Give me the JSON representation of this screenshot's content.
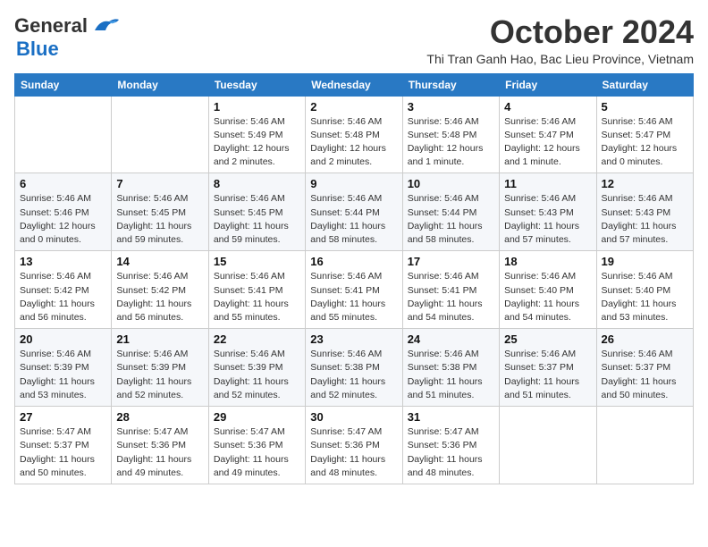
{
  "header": {
    "logo_general": "General",
    "logo_blue": "Blue",
    "month_title": "October 2024",
    "subtitle": "Thi Tran Ganh Hao, Bac Lieu Province, Vietnam"
  },
  "weekdays": [
    "Sunday",
    "Monday",
    "Tuesday",
    "Wednesday",
    "Thursday",
    "Friday",
    "Saturday"
  ],
  "weeks": [
    [
      {
        "day": "",
        "detail": ""
      },
      {
        "day": "",
        "detail": ""
      },
      {
        "day": "1",
        "detail": "Sunrise: 5:46 AM\nSunset: 5:49 PM\nDaylight: 12 hours\nand 2 minutes."
      },
      {
        "day": "2",
        "detail": "Sunrise: 5:46 AM\nSunset: 5:48 PM\nDaylight: 12 hours\nand 2 minutes."
      },
      {
        "day": "3",
        "detail": "Sunrise: 5:46 AM\nSunset: 5:48 PM\nDaylight: 12 hours\nand 1 minute."
      },
      {
        "day": "4",
        "detail": "Sunrise: 5:46 AM\nSunset: 5:47 PM\nDaylight: 12 hours\nand 1 minute."
      },
      {
        "day": "5",
        "detail": "Sunrise: 5:46 AM\nSunset: 5:47 PM\nDaylight: 12 hours\nand 0 minutes."
      }
    ],
    [
      {
        "day": "6",
        "detail": "Sunrise: 5:46 AM\nSunset: 5:46 PM\nDaylight: 12 hours\nand 0 minutes."
      },
      {
        "day": "7",
        "detail": "Sunrise: 5:46 AM\nSunset: 5:45 PM\nDaylight: 11 hours\nand 59 minutes."
      },
      {
        "day": "8",
        "detail": "Sunrise: 5:46 AM\nSunset: 5:45 PM\nDaylight: 11 hours\nand 59 minutes."
      },
      {
        "day": "9",
        "detail": "Sunrise: 5:46 AM\nSunset: 5:44 PM\nDaylight: 11 hours\nand 58 minutes."
      },
      {
        "day": "10",
        "detail": "Sunrise: 5:46 AM\nSunset: 5:44 PM\nDaylight: 11 hours\nand 58 minutes."
      },
      {
        "day": "11",
        "detail": "Sunrise: 5:46 AM\nSunset: 5:43 PM\nDaylight: 11 hours\nand 57 minutes."
      },
      {
        "day": "12",
        "detail": "Sunrise: 5:46 AM\nSunset: 5:43 PM\nDaylight: 11 hours\nand 57 minutes."
      }
    ],
    [
      {
        "day": "13",
        "detail": "Sunrise: 5:46 AM\nSunset: 5:42 PM\nDaylight: 11 hours\nand 56 minutes."
      },
      {
        "day": "14",
        "detail": "Sunrise: 5:46 AM\nSunset: 5:42 PM\nDaylight: 11 hours\nand 56 minutes."
      },
      {
        "day": "15",
        "detail": "Sunrise: 5:46 AM\nSunset: 5:41 PM\nDaylight: 11 hours\nand 55 minutes."
      },
      {
        "day": "16",
        "detail": "Sunrise: 5:46 AM\nSunset: 5:41 PM\nDaylight: 11 hours\nand 55 minutes."
      },
      {
        "day": "17",
        "detail": "Sunrise: 5:46 AM\nSunset: 5:41 PM\nDaylight: 11 hours\nand 54 minutes."
      },
      {
        "day": "18",
        "detail": "Sunrise: 5:46 AM\nSunset: 5:40 PM\nDaylight: 11 hours\nand 54 minutes."
      },
      {
        "day": "19",
        "detail": "Sunrise: 5:46 AM\nSunset: 5:40 PM\nDaylight: 11 hours\nand 53 minutes."
      }
    ],
    [
      {
        "day": "20",
        "detail": "Sunrise: 5:46 AM\nSunset: 5:39 PM\nDaylight: 11 hours\nand 53 minutes."
      },
      {
        "day": "21",
        "detail": "Sunrise: 5:46 AM\nSunset: 5:39 PM\nDaylight: 11 hours\nand 52 minutes."
      },
      {
        "day": "22",
        "detail": "Sunrise: 5:46 AM\nSunset: 5:39 PM\nDaylight: 11 hours\nand 52 minutes."
      },
      {
        "day": "23",
        "detail": "Sunrise: 5:46 AM\nSunset: 5:38 PM\nDaylight: 11 hours\nand 52 minutes."
      },
      {
        "day": "24",
        "detail": "Sunrise: 5:46 AM\nSunset: 5:38 PM\nDaylight: 11 hours\nand 51 minutes."
      },
      {
        "day": "25",
        "detail": "Sunrise: 5:46 AM\nSunset: 5:37 PM\nDaylight: 11 hours\nand 51 minutes."
      },
      {
        "day": "26",
        "detail": "Sunrise: 5:46 AM\nSunset: 5:37 PM\nDaylight: 11 hours\nand 50 minutes."
      }
    ],
    [
      {
        "day": "27",
        "detail": "Sunrise: 5:47 AM\nSunset: 5:37 PM\nDaylight: 11 hours\nand 50 minutes."
      },
      {
        "day": "28",
        "detail": "Sunrise: 5:47 AM\nSunset: 5:36 PM\nDaylight: 11 hours\nand 49 minutes."
      },
      {
        "day": "29",
        "detail": "Sunrise: 5:47 AM\nSunset: 5:36 PM\nDaylight: 11 hours\nand 49 minutes."
      },
      {
        "day": "30",
        "detail": "Sunrise: 5:47 AM\nSunset: 5:36 PM\nDaylight: 11 hours\nand 48 minutes."
      },
      {
        "day": "31",
        "detail": "Sunrise: 5:47 AM\nSunset: 5:36 PM\nDaylight: 11 hours\nand 48 minutes."
      },
      {
        "day": "",
        "detail": ""
      },
      {
        "day": "",
        "detail": ""
      }
    ]
  ]
}
